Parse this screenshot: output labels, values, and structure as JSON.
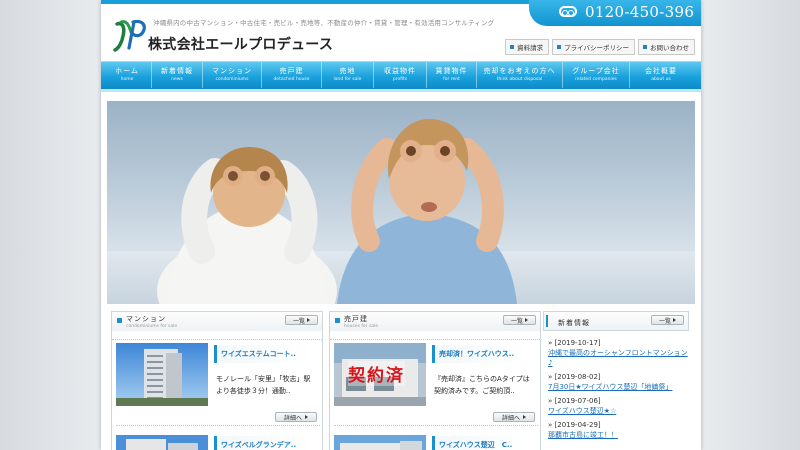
{
  "header": {
    "tagline": "沖縄県内の中古マンション・中古住宅・売ビル・売地等、不動産の仲介・賃貸・管理・有効活用コンサルティング",
    "company_name": "株式会社エールプロデュース",
    "phone": "0120-450-396",
    "util_links": [
      "資料請求",
      "プライバシーポリシー",
      "お問い合わせ"
    ]
  },
  "nav": [
    {
      "jp": "ホーム",
      "en": "home"
    },
    {
      "jp": "新着情報",
      "en": "news"
    },
    {
      "jp": "マンション",
      "en": "condominiums"
    },
    {
      "jp": "売戸建",
      "en": "detached house"
    },
    {
      "jp": "売地",
      "en": "land for sale"
    },
    {
      "jp": "収益物件",
      "en": "profits"
    },
    {
      "jp": "賃貸物件",
      "en": "for rent"
    },
    {
      "jp": "売却をお考えの方へ",
      "en": "think about disposal"
    },
    {
      "jp": "グループ会社",
      "en": "related companies"
    },
    {
      "jp": "会社概要",
      "en": "about us"
    }
  ],
  "sections": [
    {
      "title": "マンション",
      "subtitle": "condominiums for sale",
      "list_label": "一覧",
      "item_title": "ワイズエステムコート..",
      "item_text": "モノレール「安里」「牧志」駅より各徒歩３分！通勤..",
      "detail_label": "詳細へ",
      "item2_title": "ワイズベルグランデア.."
    },
    {
      "title": "売戸建",
      "subtitle": "houses for sale",
      "list_label": "一覧",
      "item_title": "売却済！ワイズハウス..",
      "item_text": "『売却済』こちらのAタイプは契約済みです。ご契約頂..",
      "detail_label": "詳細へ",
      "item2_title": "ワイズハウス楚辺　C..",
      "stamp": "契約済"
    }
  ],
  "news": {
    "title": "新着情報",
    "list_label": "一覧",
    "items": [
      {
        "date": "» [2019-10-17]",
        "text": "沖縄で最高のオーシャンフロントマンション♪"
      },
      {
        "date": "» [2019-08-02]",
        "text": "7月30日★ワイズハウス楚辺「地鎮祭」"
      },
      {
        "date": "» [2019-07-06]",
        "text": "ワイズハウス楚辺★☆"
      },
      {
        "date": "» [2019-04-29]",
        "text": "那覇市古島に竣工！！"
      }
    ]
  },
  "colors": {
    "accent": "#1aa0d8",
    "link": "#1a6fb8"
  }
}
